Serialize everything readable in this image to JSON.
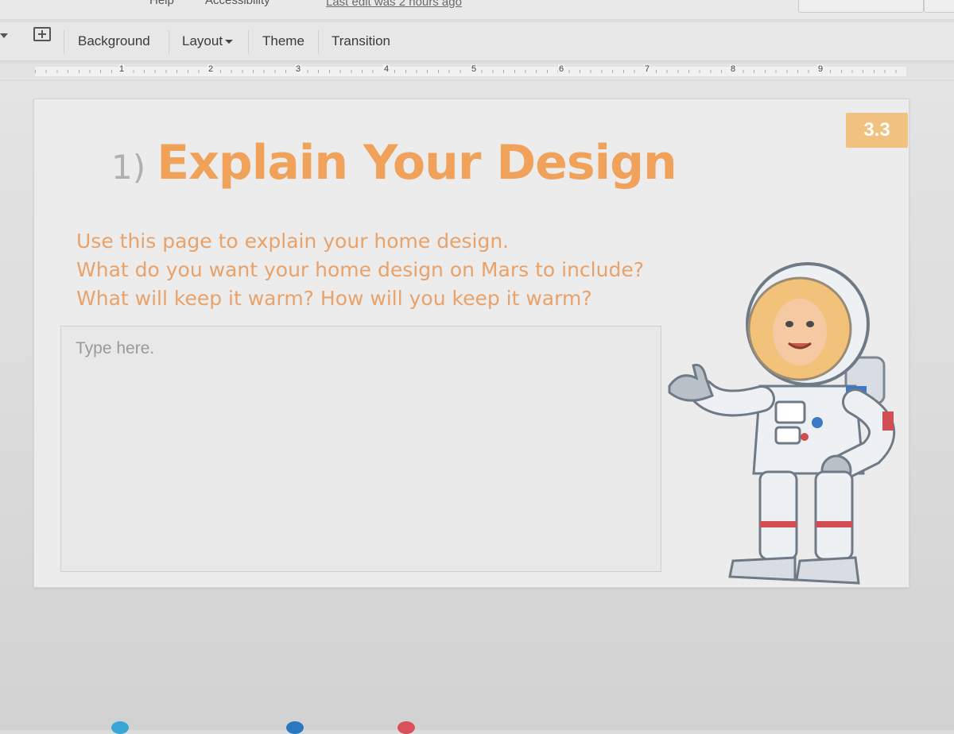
{
  "menu": {
    "help_fragment": "Help",
    "accessibility_fragment": "Accessibility",
    "last_edit": "Last edit was 2 hours ago"
  },
  "toolbar": {
    "background_label": "Background",
    "layout_label": "Layout",
    "theme_label": "Theme",
    "transition_label": "Transition"
  },
  "ruler": {
    "marks": [
      "1",
      "2",
      "3",
      "4",
      "5",
      "6",
      "7",
      "8",
      "9"
    ]
  },
  "slide": {
    "badge": "3.3",
    "title_number": "1)",
    "title_text": "Explain Your Design",
    "prompt_lines": [
      "Use this page to explain your home design.",
      "What do you want your home design on Mars to include?",
      "What will keep it warm?  How will you keep it warm?"
    ],
    "answer_placeholder": "Type here.",
    "colors": {
      "title": "#f0a25a",
      "prompt": "#e8a26a",
      "badge": "#f1c17f"
    },
    "illustration": "astronaut-illustration"
  }
}
